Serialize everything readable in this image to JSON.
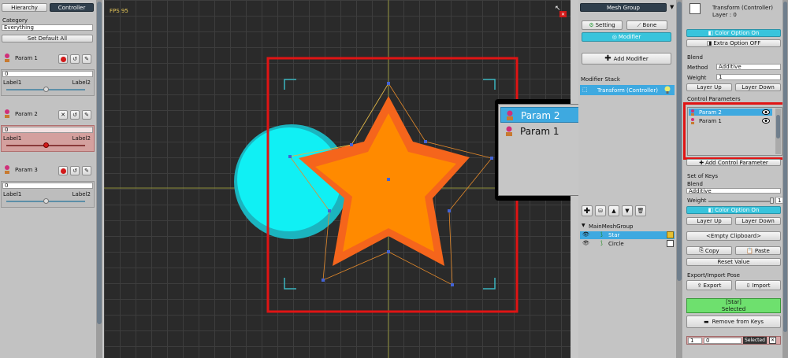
{
  "left": {
    "tabs": [
      "Hierarchy",
      "Controller"
    ],
    "category_label": "Category",
    "category_value": "Everything",
    "set_default_all": "Set Default All",
    "params": [
      {
        "name": "Param 1",
        "value": "0",
        "label1": "Label1",
        "label2": "Label2"
      },
      {
        "name": "Param 2",
        "value": "0",
        "label1": "Label1",
        "label2": "Label2"
      },
      {
        "name": "Param 3",
        "value": "0",
        "label1": "Label1",
        "label2": "Label2"
      }
    ]
  },
  "canvas": {
    "fps": "FPS 95",
    "popup_items": [
      "Param 2",
      "Param 1"
    ]
  },
  "middle": {
    "title": "Mesh Group",
    "setting": "Setting",
    "bone": "Bone",
    "modifier": "Modifier",
    "add_modifier": "Add Modifier",
    "modifier_stack": "Modifier Stack",
    "stack_item": "Transform (Controller)",
    "tree_root": "MainMeshGroup",
    "tree_items": [
      "Star",
      "Circle"
    ]
  },
  "right": {
    "title": "Transform (Controller)",
    "layer": "Layer : 0",
    "color_option_on": "Color Option On",
    "extra_option_off": "Extra Option OFF",
    "blend": "Blend",
    "method_label": "Method",
    "method_value": "Additive",
    "weight_label": "Weight",
    "weight_value": "1",
    "layer_up": "Layer Up",
    "layer_down": "Layer Down",
    "control_parameters": "Control Parameters",
    "cp_items": [
      "Param 2",
      "Param 1"
    ],
    "add_control_parameter": "Add Control Parameter",
    "set_of_keys": "Set of Keys",
    "blend2": "Blend",
    "blend2_value": "Additive",
    "weight2_label": "Weight",
    "weight2_value": "1",
    "color_option_on2": "Color Option On",
    "layer_up2": "Layer Up",
    "layer_down2": "Layer Down",
    "empty_clipboard": "<Empty Clipboard>",
    "copy": "Copy",
    "paste": "Paste",
    "reset_value": "Reset Value",
    "export_import": "Export/Import Pose",
    "export": "Export",
    "import": "Import",
    "selected_name": "[Star]",
    "selected_label": "Selected",
    "remove_from_keys": "Remove from Keys",
    "bottom_a": "1",
    "bottom_b": "0",
    "bottom_selected": "Selected"
  }
}
